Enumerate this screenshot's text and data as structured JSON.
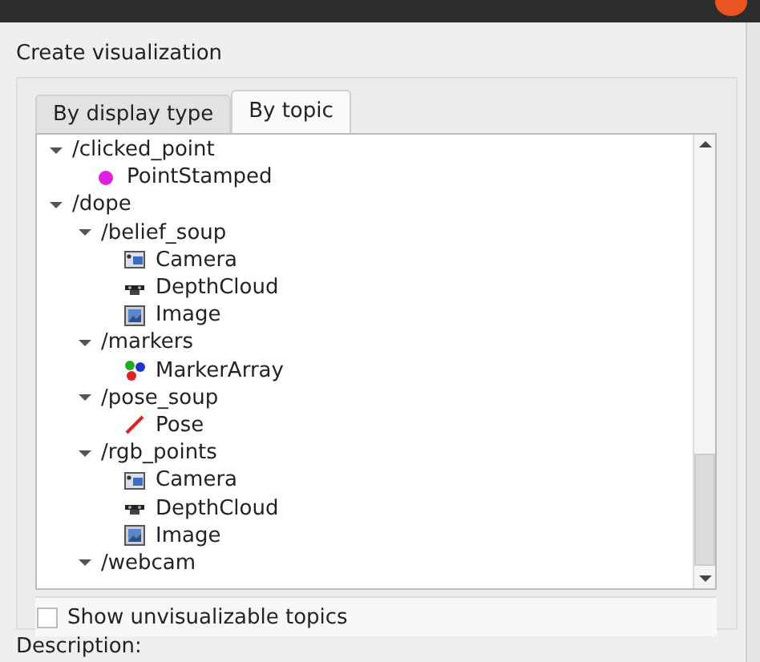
{
  "dialog": {
    "heading": "Create visualization"
  },
  "tabs": [
    {
      "label": "By display type",
      "selected": false
    },
    {
      "label": "By topic",
      "selected": true
    }
  ],
  "tree": [
    {
      "label": "/clicked_point",
      "expanded": true,
      "children": [
        {
          "label": "PointStamped",
          "kind": "point"
        }
      ]
    },
    {
      "label": "/dope",
      "expanded": true,
      "children": [
        {
          "label": "/belief_soup",
          "expanded": true,
          "children": [
            {
              "label": "Camera",
              "kind": "camera"
            },
            {
              "label": "DepthCloud",
              "kind": "depthcloud"
            },
            {
              "label": "Image",
              "kind": "image"
            }
          ]
        },
        {
          "label": "/markers",
          "expanded": true,
          "children": [
            {
              "label": "MarkerArray",
              "kind": "markerarray"
            }
          ]
        },
        {
          "label": "/pose_soup",
          "expanded": true,
          "children": [
            {
              "label": "Pose",
              "kind": "pose"
            }
          ]
        },
        {
          "label": "/rgb_points",
          "expanded": true,
          "children": [
            {
              "label": "Camera",
              "kind": "camera"
            },
            {
              "label": "DepthCloud",
              "kind": "depthcloud"
            },
            {
              "label": "Image",
              "kind": "image"
            }
          ]
        },
        {
          "label": "/webcam",
          "expanded": true
        }
      ]
    }
  ],
  "show_unvisualizable": {
    "label": "Show unvisualizable topics",
    "checked": false
  },
  "description": {
    "label": "Description:"
  }
}
